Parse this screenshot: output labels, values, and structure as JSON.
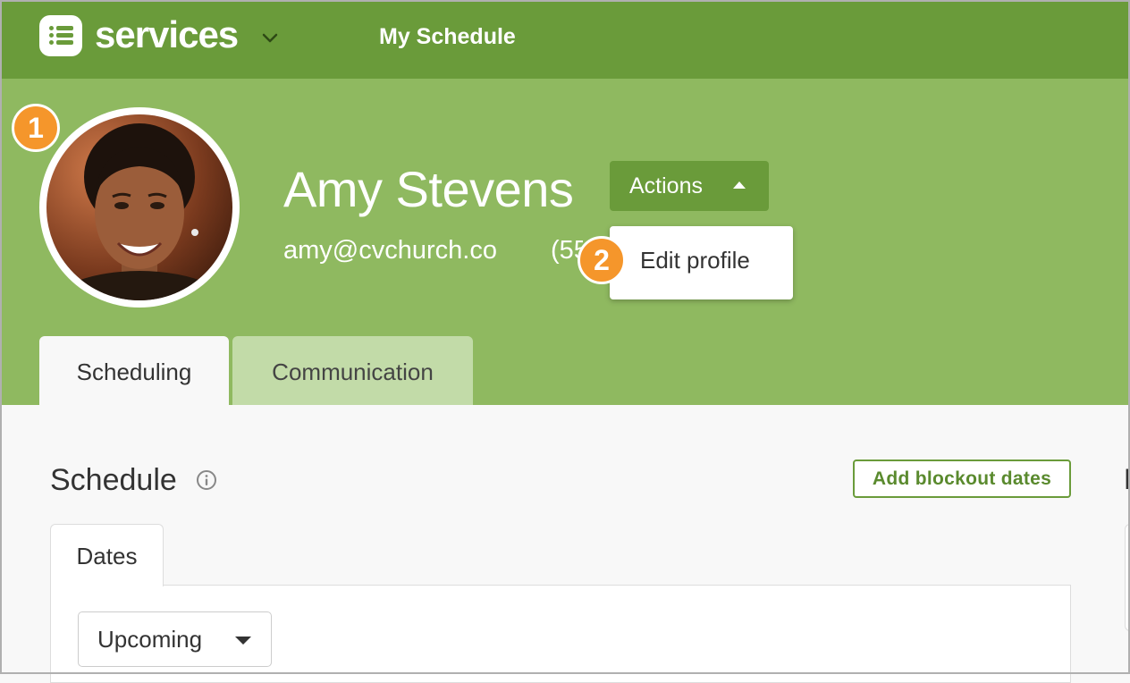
{
  "app": {
    "name": "services",
    "nav_link": "My Schedule",
    "icons": {
      "logo": "list-icon",
      "switcher": "chevron-down-icon"
    },
    "colors": {
      "topbar": "#6a9b3a",
      "header": "#8fb960",
      "accent": "#6a9b3a",
      "badge": "#f5962b"
    }
  },
  "profile": {
    "name": "Amy Stevens",
    "email": "amy@cvchurch.co",
    "phone_partial": "(55",
    "avatar_icon": "person-photo"
  },
  "callouts": [
    "1",
    "2"
  ],
  "actions": {
    "label": "Actions",
    "menu": [
      "Edit profile"
    ]
  },
  "tabs": [
    {
      "label": "Scheduling",
      "active": true
    },
    {
      "label": "Communication",
      "active": false
    }
  ],
  "schedule": {
    "title": "Schedule",
    "add_blockout_label": "Add blockout dates",
    "subtab": "Dates",
    "filter_value": "Upcoming"
  },
  "edge": {
    "glyph": "B"
  }
}
